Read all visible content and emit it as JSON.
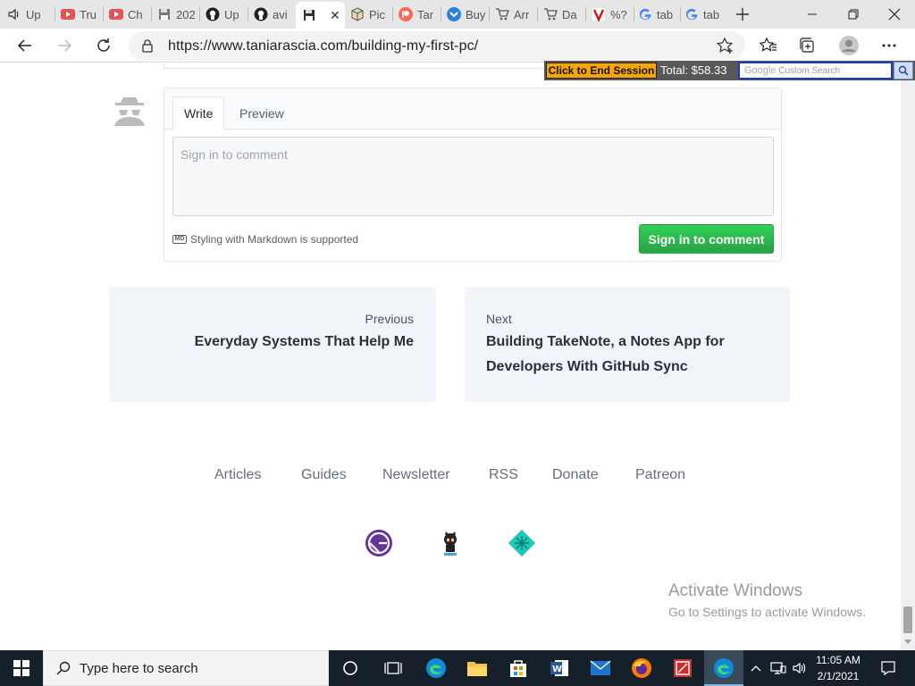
{
  "browser": {
    "tabs": [
      {
        "label": "Up",
        "icon": "speaker-icon"
      },
      {
        "label": "Tru",
        "icon": "youtube-icon"
      },
      {
        "label": "Ch",
        "icon": "youtube-icon"
      },
      {
        "label": "202",
        "icon": "floppy-icon"
      },
      {
        "label": "Up",
        "icon": "github-icon"
      },
      {
        "label": "avi",
        "icon": "github-icon"
      },
      {
        "label": "",
        "icon": "floppy-icon",
        "active": true
      },
      {
        "label": "Pic",
        "icon": "package-icon"
      },
      {
        "label": "Tar",
        "icon": "patreon-icon"
      },
      {
        "label": "Buy",
        "icon": "pocket-icon"
      },
      {
        "label": "Arr",
        "icon": "cart-icon"
      },
      {
        "label": "Da",
        "icon": "cart-icon"
      },
      {
        "label": "%?",
        "icon": "v-icon"
      },
      {
        "label": "tab",
        "icon": "google-icon"
      },
      {
        "label": "tab",
        "icon": "google-icon"
      }
    ],
    "url": "https://www.taniarascia.com/building-my-first-pc/"
  },
  "overlay": {
    "end_session": "Click to End Session",
    "total": "Total: $58.33",
    "search_placeholder_brand": "Google",
    "search_placeholder": "Custom Search"
  },
  "comment": {
    "tab_write": "Write",
    "tab_preview": "Preview",
    "placeholder": "Sign in to comment",
    "markdown_note": "Styling with Markdown is supported",
    "markdown_badge": "MD",
    "signin_button": "Sign in to comment"
  },
  "post_nav": {
    "previous_label": "Previous",
    "previous_title": "Everyday Systems That Help Me",
    "next_label": "Next",
    "next_title_line1": "Building TakeNote, a Notes App for",
    "next_title_line2": "Developers With GitHub Sync"
  },
  "footer": {
    "links": [
      "Articles",
      "Guides",
      "Newsletter",
      "RSS",
      "Donate",
      "Patreon"
    ]
  },
  "watermark": {
    "title": "Activate Windows",
    "subtitle": "Go to Settings to activate Windows."
  },
  "taskbar": {
    "search_placeholder": "Type here to search",
    "time": "11:05 AM",
    "date": "2/1/2021"
  }
}
